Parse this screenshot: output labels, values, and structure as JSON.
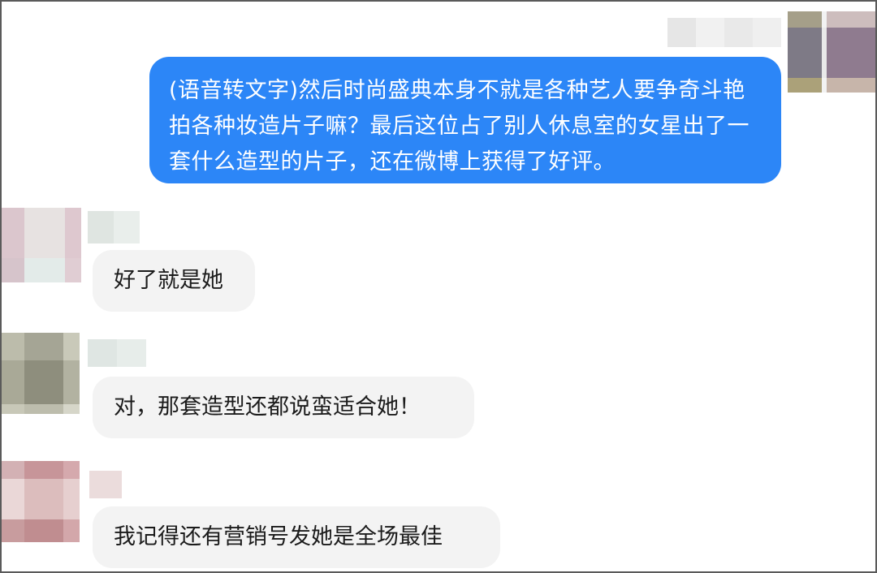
{
  "messages": [
    {
      "sender": "self",
      "text": "(语音转文字)然后时尚盛典本身不就是各种艺人要争奇斗艳拍各种妆造片子嘛？最后这位占了别人休息室的女星出了一套什么造型的片子，还在微博上获得了好评。"
    },
    {
      "sender": "other",
      "text": "好了就是她"
    },
    {
      "sender": "other",
      "text": "对，那套造型还都说蛮适合她！"
    },
    {
      "sender": "other",
      "text": "我记得还有营销号发她是全场最佳"
    }
  ],
  "colors": {
    "self_bubble": "#2c86f7",
    "other_bubble": "#f3f3f3",
    "frame_border": "#5a5a5a"
  }
}
